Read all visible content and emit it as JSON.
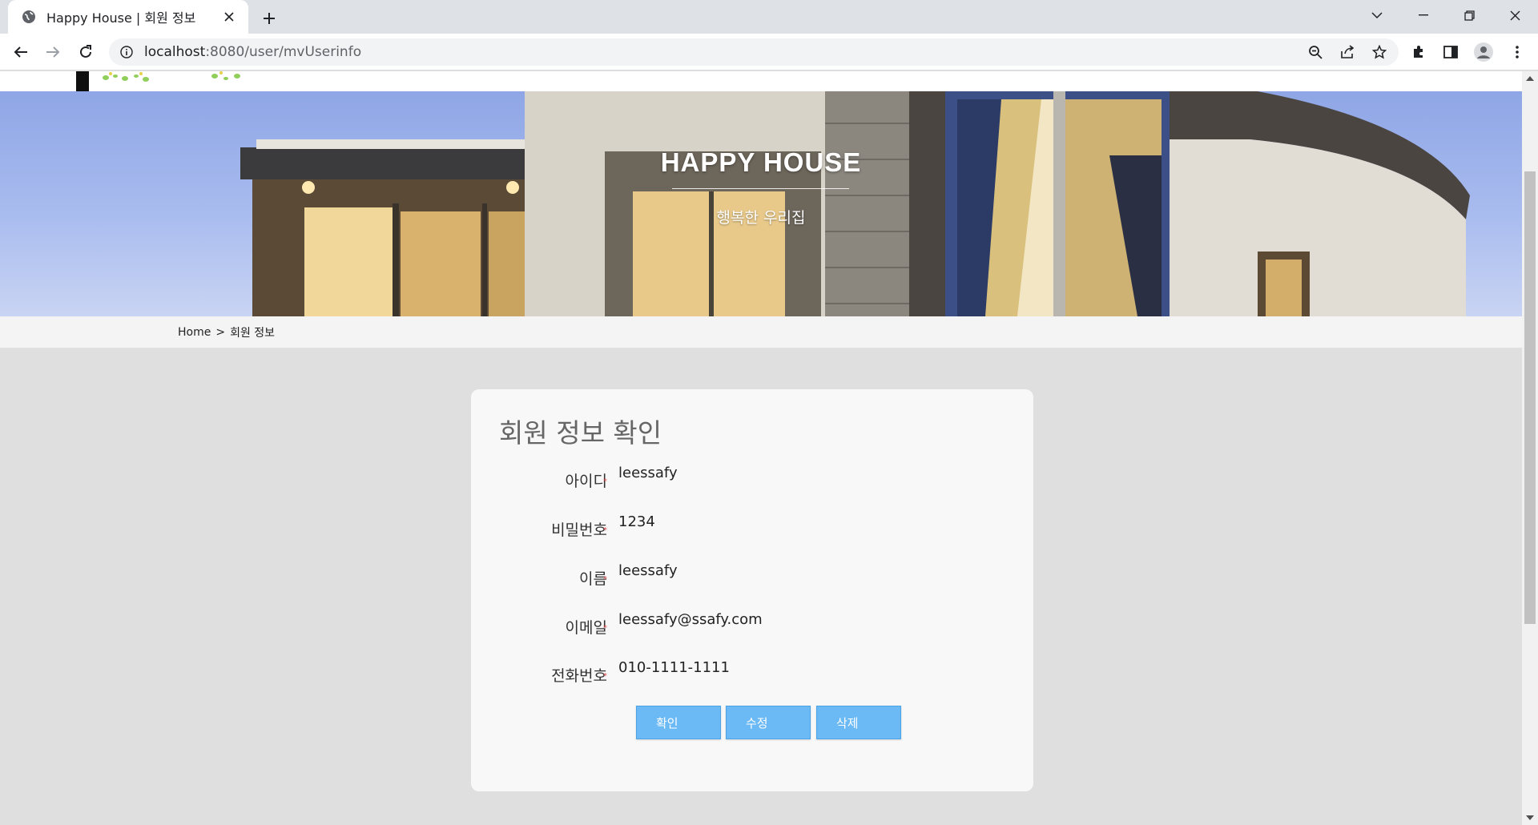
{
  "browser": {
    "tab_title": "Happy House | 회원 정보",
    "url_host": "localhost",
    "url_rest": ":8080/user/mvUserinfo"
  },
  "hero": {
    "title": "HAPPY HOUSE",
    "subtitle": "행복한 우리집"
  },
  "breadcrumb": {
    "home": "Home",
    "separator": ">",
    "current": "회원 정보"
  },
  "card": {
    "title": "회원 정보 확인",
    "required_mark": "*",
    "fields": [
      {
        "label": "아이디",
        "value": "leessafy"
      },
      {
        "label": "비밀번호",
        "value": "1234"
      },
      {
        "label": "이름",
        "value": "leessafy"
      },
      {
        "label": "이메일",
        "value": "leessafy@ssafy.com"
      },
      {
        "label": "전화번호",
        "value": "010-1111-1111"
      }
    ],
    "buttons": {
      "confirm": "확인",
      "edit": "수정",
      "delete": "삭제"
    }
  },
  "colors": {
    "button_bg": "#6bb9f5",
    "page_bg": "#dfdfdf",
    "card_bg": "#f8f8f8",
    "required": "#e05555"
  }
}
